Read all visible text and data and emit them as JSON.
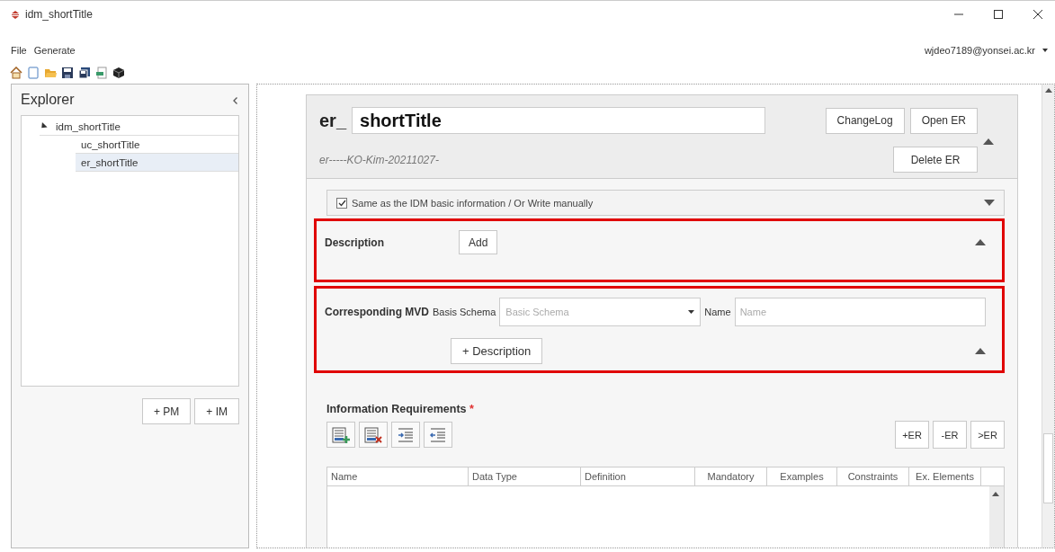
{
  "window": {
    "title": "idm_shortTitle"
  },
  "menu": [
    "File",
    "Generate"
  ],
  "user": "wjdeo7189@yonsei.ac.kr",
  "explorer": {
    "title": "Explorer",
    "tree": [
      {
        "label": "idm_shortTitle",
        "expanded": true,
        "selected": false,
        "children": [
          {
            "label": "uc_shortTitle",
            "selected": false
          },
          {
            "label": "er_shortTitle",
            "selected": true
          }
        ]
      }
    ],
    "buttons": [
      "+ PM",
      "+ IM"
    ]
  },
  "er": {
    "prefix": "er_",
    "title": "shortTitle",
    "code": "er-----KO-Kim-20211027-",
    "top_buttons": [
      "ChangeLog",
      "Open ER"
    ],
    "delete_button": "Delete ER",
    "same_as_basic": {
      "label": "Same as the IDM basic information / Or Write manually",
      "checked": true
    },
    "description": {
      "label": "Description",
      "button": "Add"
    },
    "mvd": {
      "label": "Corresponding MVD",
      "schema_label": "Basis Schema",
      "schema_placeholder": "Basic Schema",
      "name_label": "Name",
      "name_placeholder": "Name",
      "button": "+ Description"
    },
    "info_requirements": {
      "title": "Information Requirements",
      "required_mark": "*",
      "er_buttons": [
        "+ER",
        "-ER",
        ">ER"
      ],
      "columns": [
        "Name",
        "Data Type",
        "Definition",
        "Mandatory",
        "Examples",
        "Constraints",
        "Ex. Elements"
      ]
    }
  }
}
